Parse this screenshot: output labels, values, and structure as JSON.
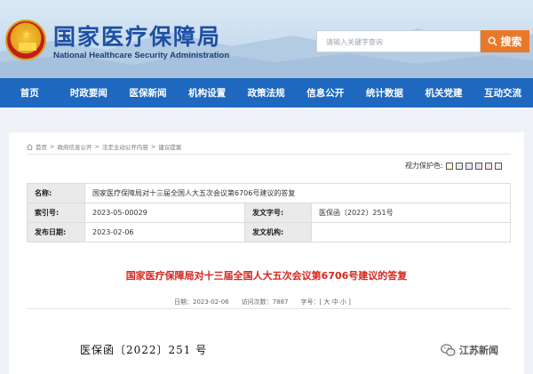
{
  "header": {
    "title": "国家医疗保障局",
    "subtitle": "National Healthcare Security Administration",
    "search_placeholder": "请输入关键字查询",
    "search_button": "搜索"
  },
  "nav": {
    "items": [
      "首页",
      "时政要闻",
      "医保新闻",
      "机构设置",
      "政策法规",
      "信息公开",
      "统计数据",
      "机关党建",
      "互动交流"
    ]
  },
  "breadcrumb": [
    "首页",
    "政府信息公开",
    "法定主动公开内容",
    "建议提案"
  ],
  "vision": {
    "label": "视力保护色:",
    "swatches": [
      "#fdf9d7",
      "#e2f0d9",
      "#dce9f5",
      "#e6e0f0",
      "#f3e2e4",
      "#eeeeee"
    ]
  },
  "meta": {
    "name_label": "名称:",
    "name_value": "国家医疗保障局对十三届全国人大五次会议第6706号建议的答复",
    "index_label": "索引号:",
    "index_value": "2023-05-00029",
    "docno_label": "发文字号:",
    "docno_value": "医保函〔2022〕251号",
    "date_label": "发布日期:",
    "date_value": "2023-02-06",
    "org_label": "发文机构:",
    "org_value": ""
  },
  "article": {
    "title": "国家医疗保障局对十三届全国人大五次会议第6706号建议的答复",
    "date": "日期：2023-02-06",
    "views": "访问次数：7887",
    "fontsize": "字号：[ 大 中 小 ]",
    "doc_number": "医保函〔2022〕251 号"
  },
  "watermark": {
    "text": "江苏新闻"
  }
}
